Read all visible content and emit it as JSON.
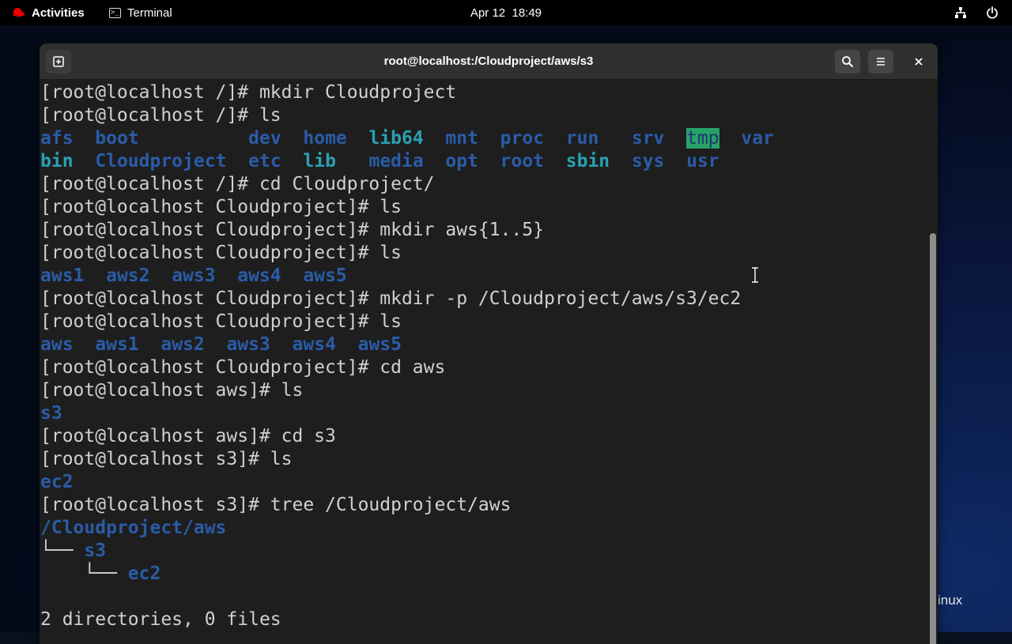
{
  "topbar": {
    "activities": "Activities",
    "app": "Terminal",
    "clock": "Apr 12  18:49"
  },
  "desktop": {
    "text": "inux"
  },
  "window": {
    "title": "root@localhost:/Cloudproject/aws/s3"
  },
  "terminal": {
    "l1": "[root@localhost /]# mkdir Cloudproject",
    "l2": "[root@localhost /]# ls",
    "ls1": {
      "afs": "afs",
      "boot": "boot",
      "dev": "dev",
      "home": "home",
      "lib64": "lib64",
      "mnt": "mnt",
      "proc": "proc",
      "run": "run",
      "srv": "srv",
      "tmp": "tmp",
      "var": "var"
    },
    "ls2": {
      "bin": "bin",
      "Cloudproject": "Cloudproject",
      "etc": "etc",
      "lib": "lib",
      "media": "media",
      "opt": "opt",
      "root": "root",
      "sbin": "sbin",
      "sys": "sys",
      "usr": "usr"
    },
    "l5": "[root@localhost /]# cd Cloudproject/",
    "l6": "[root@localhost Cloudproject]# ls",
    "l7": "[root@localhost Cloudproject]# mkdir aws{1..5}",
    "l8": "[root@localhost Cloudproject]# ls",
    "ls3": [
      "aws1",
      "aws2",
      "aws3",
      "aws4",
      "aws5"
    ],
    "l10": "[root@localhost Cloudproject]# mkdir -p /Cloudproject/aws/s3/ec2",
    "l11": "[root@localhost Cloudproject]# ls",
    "ls4": [
      "aws",
      "aws1",
      "aws2",
      "aws3",
      "aws4",
      "aws5"
    ],
    "l13": "[root@localhost Cloudproject]# cd aws",
    "l14": "[root@localhost aws]# ls",
    "l15": "s3",
    "l16": "[root@localhost aws]# cd s3",
    "l17": "[root@localhost s3]# ls",
    "l18": "ec2",
    "l19": "[root@localhost s3]# tree /Cloudproject/aws",
    "tree_root": "/Cloudproject/aws",
    "tree_branch": "└── ",
    "tree_s3": "s3",
    "tree_ec2": "ec2",
    "summary": "2 directories, 0 files"
  },
  "colors": {
    "directory": "#2a5ca8",
    "highlight_bg": "#26a269",
    "exec_cyan": "#2aa1b3"
  }
}
